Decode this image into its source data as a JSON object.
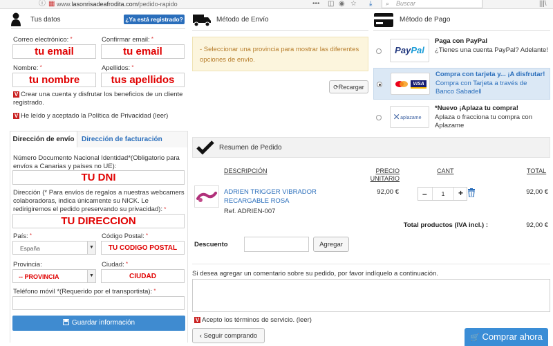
{
  "browser": {
    "url_domain": "lasonrisadeafrodita.com",
    "url_path": "/pedido-rapido",
    "url_prefix": "www.",
    "search_placeholder": "Buscar"
  },
  "tus_datos": {
    "title": "Tus datos",
    "registered_badge": "¿Ya está registrado?",
    "email_label": "Correo electrónico:",
    "email_value": "tu email",
    "confirm_email_label": "Confirmar email:",
    "confirm_email_value": "tu email",
    "name_label": "Nombre:",
    "name_value": "tu nombre",
    "surname_label": "Apellidos:",
    "surname_value": "tus apellidos",
    "create_account_text": "Crear una cuenta y disfrutar los beneficios de un cliente registrado.",
    "privacy_text": "He leído y aceptado la Política de Privacidad (leer)"
  },
  "address": {
    "tab_shipping": "Dirección de envío",
    "tab_billing": "Dirección de facturación",
    "dni_label": "Número Documento Nacional Identidad*(Obligatorio para envíos a Canarias y países no UE):",
    "dni_value": "TU DNI",
    "address_label": "Dirección (* Para envíos de regalos a nuestras webcamers colaboradoras, indica únicamente su NICK. Le redirigiremos el pedido preservando su privacidad):",
    "address_value": "TU DIRECCION",
    "country_label": "País:",
    "country_value": "España",
    "postal_label": "Código Postal:",
    "postal_value": "TU CODIGO POSTAL",
    "province_label": "Provincia:",
    "province_value": "-- PROVINCIA",
    "city_label": "Ciudad:",
    "city_value": "CIUDAD",
    "phone_label": "Teléfono móvil *(Requerido por el transportista):",
    "phone_value": "",
    "save_button": "Guardar información"
  },
  "shipping": {
    "title": "Método de Envío",
    "notice": "- Seleccionar una provincia para mostrar las diferentes opciones de envío.",
    "reload_button": "Recargar"
  },
  "payment": {
    "title": "Método de Pago",
    "options": [
      {
        "logo": "PayPal",
        "title": "Paga con PayPal",
        "desc": "¿Tienes una cuenta PayPal? Adelante!",
        "selected": false
      },
      {
        "logo": "MasterCard VISA",
        "title": "Compra con tarjeta y... ¡A disfrutar!",
        "desc": "Compra con Tarjeta a través de Banco Sabadell",
        "selected": true
      },
      {
        "logo": "aplazame",
        "title": "*Nuevo ¡Aplaza tu compra!",
        "desc": "Aplaza o fracciona tu compra con Aplazame",
        "selected": false
      }
    ]
  },
  "summary": {
    "title": "Resumen de Pedido",
    "col_description": "DESCRIPCIÓN",
    "col_unit_price": "PRECIO UNITARIO",
    "col_qty": "CANT",
    "col_total": "TOTAL",
    "item": {
      "name": "ADRIEN TRIGGER VIBRADOR RECARGABLE ROSA",
      "ref": "Ref. ADRIEN-007",
      "unit_price": "92,00 €",
      "qty": "1",
      "total": "92,00 €"
    },
    "total_label": "Total productos  (IVA incl.) :",
    "total_value": "92,00 €",
    "discount_label": "Descuento",
    "discount_value": "",
    "add_button": "Agregar",
    "comment_prompt": "Si desea agregar un comentario sobre su pedido, por favor indíquelo a continuación.",
    "comment_value": "",
    "terms_text": "Acepto los términos de servicio. (leer)",
    "continue_button": "Seguir comprando",
    "buy_button": "Comprar ahora"
  },
  "colors": {
    "accent_blue": "#2a6ebb",
    "save_button_bg": "#3f8bd0",
    "buy_button_bg": "#3a8dd6",
    "required_red": "#e00000",
    "selected_payment_bg": "#dbe8f5",
    "notice_bg": "#fcf5dd"
  }
}
